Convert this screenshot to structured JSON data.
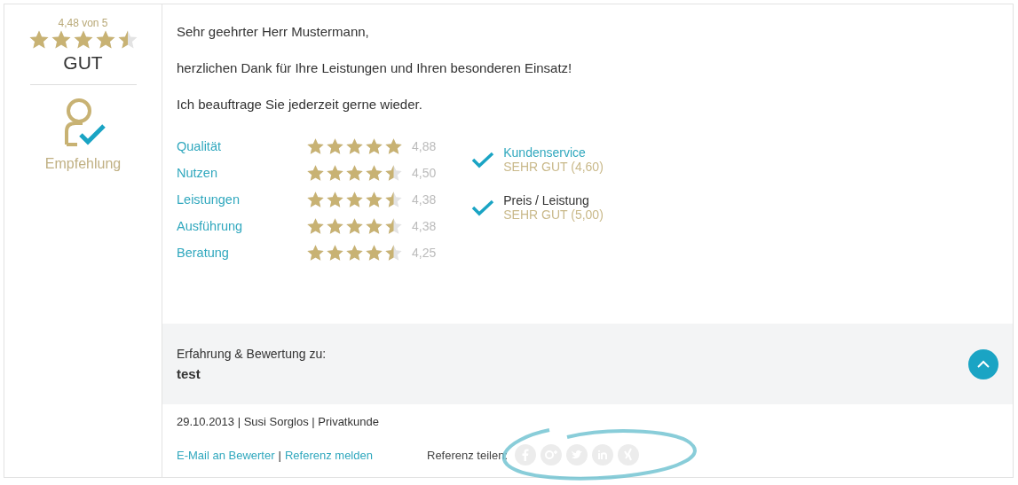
{
  "summary": {
    "score_text": "4,48 von 5",
    "stars": 4.5,
    "verdict": "GUT",
    "recommendation": "Empfehlung"
  },
  "message": [
    "Sehr geehrter Herr Mustermann,",
    "herzlichen Dank für Ihre Leistungen und Ihren besonderen Einsatz!",
    "Ich beauftrage Sie jederzeit gerne wieder."
  ],
  "criteria": [
    {
      "label": "Qualität",
      "stars": 5,
      "value": "4,88"
    },
    {
      "label": "Nutzen",
      "stars": 4.5,
      "value": "4,50"
    },
    {
      "label": "Leistungen",
      "stars": 4.5,
      "value": "4,38"
    },
    {
      "label": "Ausführung",
      "stars": 4.5,
      "value": "4,38"
    },
    {
      "label": "Beratung",
      "stars": 4.5,
      "value": "4,25"
    }
  ],
  "highlights": [
    {
      "kind": "link",
      "label": "Kundenservice",
      "rating": "SEHR GUT (4,60)"
    },
    {
      "kind": "text",
      "label": "Preis / Leistung",
      "rating": "SEHR GUT (5,00)"
    }
  ],
  "experience": {
    "heading": "Erfahrung & Bewertung zu:",
    "subject": "test",
    "expanded": true
  },
  "meta": "29.10.2013 | Susi Sorglos | Privatkunde",
  "links": [
    "E-Mail an Bewerter",
    "Referenz melden"
  ],
  "link_separator": "|",
  "share": {
    "label": "Referenz teilen:"
  }
}
